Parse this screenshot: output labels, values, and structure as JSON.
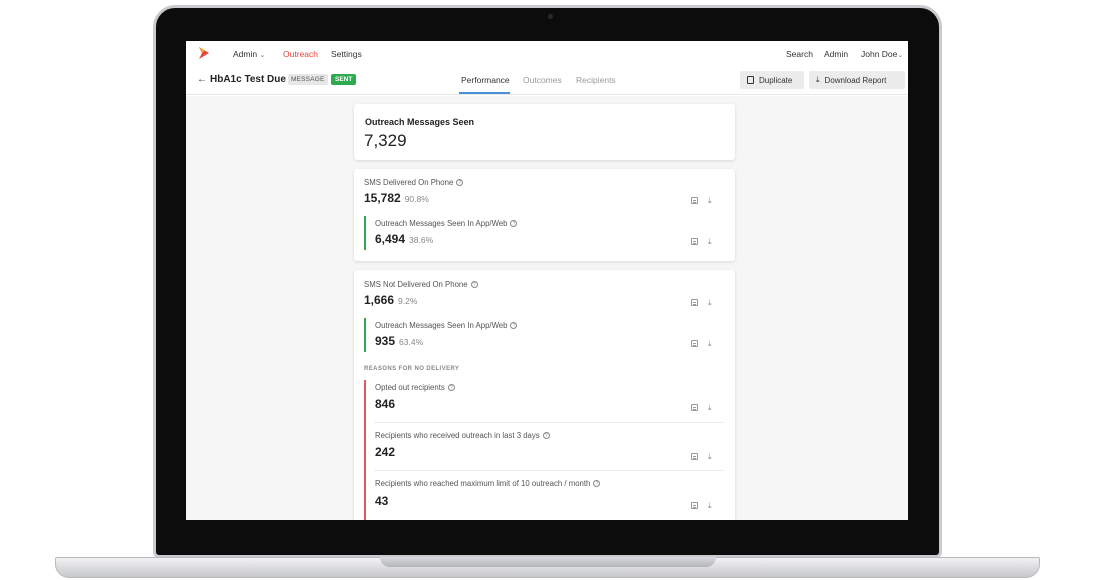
{
  "nav": {
    "admin_menu": "Admin",
    "outreach": "Outreach",
    "settings": "Settings",
    "search": "Search",
    "admin": "Admin",
    "user": "John Doe",
    "accent_color": "#e8453c"
  },
  "header": {
    "title": "HbA1c Test Due",
    "type_badge": "MESSAGE",
    "status_badge": "SENT",
    "tabs": [
      {
        "label": "Performance",
        "active": true
      },
      {
        "label": "Outcomes",
        "active": false
      },
      {
        "label": "Recipients",
        "active": false
      }
    ],
    "duplicate_label": "Duplicate",
    "download_label": "Download Report"
  },
  "summary": {
    "title": "Outreach Messages Seen",
    "value": "7,329"
  },
  "delivered": {
    "label": "SMS Delivered On Phone",
    "value": "15,782",
    "percent": "90.8%",
    "seen": {
      "label": "Outreach Messages Seen In App/Web",
      "value": "6,494",
      "percent": "38.6%"
    }
  },
  "not_delivered": {
    "label": "SMS Not Delivered On Phone",
    "value": "1,666",
    "percent": "9.2%",
    "seen": {
      "label": "Outreach Messages Seen In App/Web",
      "value": "935",
      "percent": "63.4%"
    },
    "reasons_heading": "REASONS FOR NO DELIVERY",
    "reasons": [
      {
        "label": "Opted out recipients",
        "value": "846"
      },
      {
        "label": "Recipients who received outreach in last 3 days",
        "value": "242"
      },
      {
        "label": "Recipients who reached maximum limit of 10 outreach / month",
        "value": "43"
      }
    ]
  }
}
